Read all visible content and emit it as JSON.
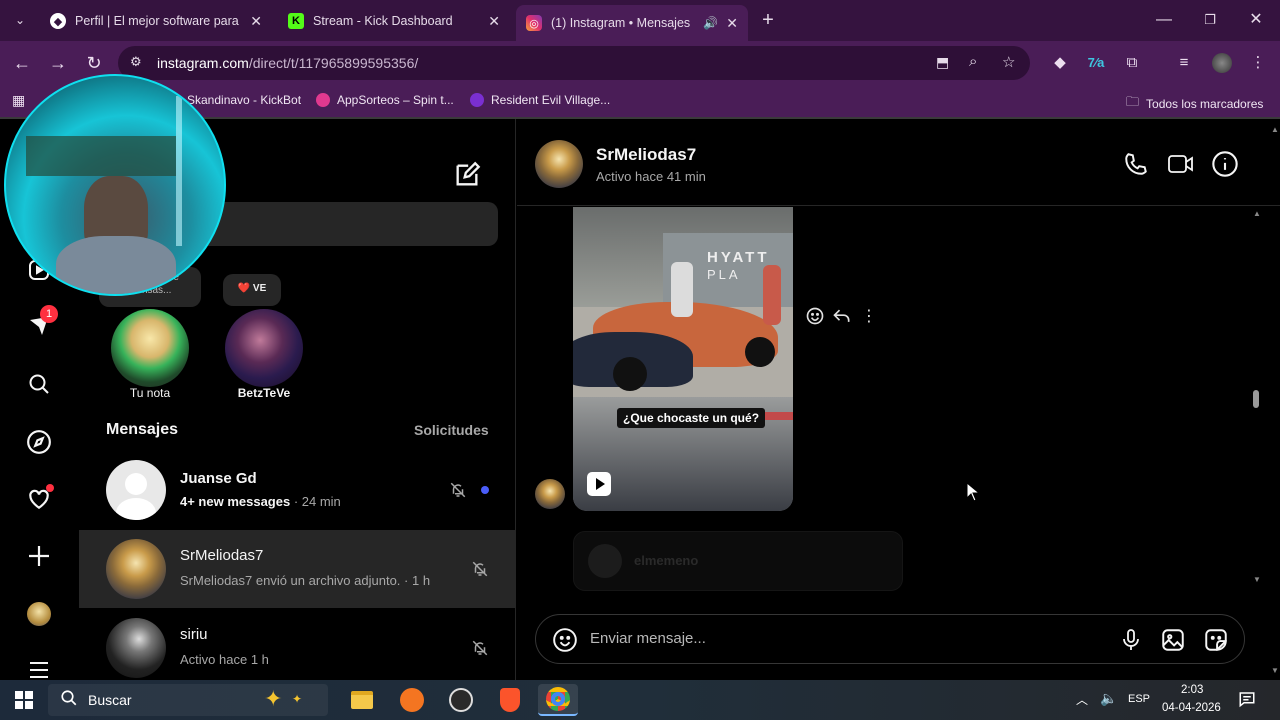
{
  "browser": {
    "tabs": [
      {
        "title": "Perfil | El mejor software para p",
        "active": false
      },
      {
        "title": "Stream - Kick Dashboard",
        "active": false
      },
      {
        "title": "(1) Instagram • Mensajes",
        "active": true
      }
    ],
    "new_tab_label": "+",
    "url_host": "instagram.com",
    "url_path": "/direct/t/117965899595356/",
    "bookmarks": [
      {
        "label": "Skandinavo - KickBot",
        "color": "#3ad36b"
      },
      {
        "label": "AppSorteos – Spin t...",
        "color": "#e0398f"
      },
      {
        "label": "Resident Evil Village...",
        "color": "#7a2fd1"
      }
    ],
    "all_bookmarks_label": "Todos los marcadores"
  },
  "instagram": {
    "rail": {
      "notifications_badge": "1"
    },
    "inbox": {
      "notes": [
        {
          "bubble": "...equí lo que piensas...",
          "label": "Tu nota"
        },
        {
          "bubble": "❤️ VE",
          "label": "BetzTeVe"
        }
      ],
      "messages_heading": "Mensajes",
      "requests_link": "Solicitudes",
      "conversations": [
        {
          "name": "Juanse Gd",
          "preview": "4+ new messages",
          "time": " · 24 min",
          "unread": true
        },
        {
          "name": "SrMeliodas7",
          "preview": "SrMeliodas7 envió un archivo adjunto.",
          "time": " · 1 h",
          "unread": false
        },
        {
          "name": "siriu",
          "preview": "Activo hace 1 h",
          "time": "",
          "unread": false
        }
      ]
    },
    "chat": {
      "contact_name": "SrMeliodas7",
      "contact_status": "Activo hace 41 min",
      "reel_caption": "¿Que chocaste un qué?",
      "reel_sign": "HYATT",
      "reel_sign2": "PLA",
      "blurred_label": "elmemeno",
      "composer_placeholder": "Enviar mensaje..."
    }
  },
  "taskbar": {
    "search_label": "Buscar",
    "language": "ESP",
    "time": "2:03",
    "date": "04-04-2026"
  }
}
